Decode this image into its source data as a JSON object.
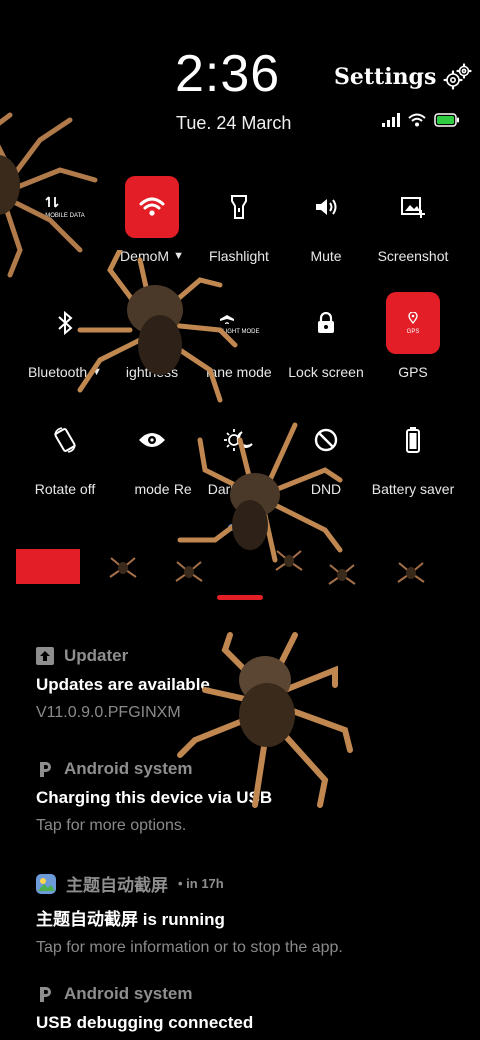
{
  "header": {
    "time": "2:36",
    "date": "Tue. 24 March",
    "settings_label": "Settings"
  },
  "tiles": [
    {
      "label": "",
      "icon": "mobile-data-icon",
      "small": "MOBILE DATA",
      "active": false
    },
    {
      "label": "DemoM",
      "icon": "wifi-icon",
      "active": true,
      "dropdown": true
    },
    {
      "label": "Flashlight",
      "icon": "flashlight-icon",
      "active": false
    },
    {
      "label": "Mute",
      "icon": "volume-icon",
      "active": false
    },
    {
      "label": "Screenshot",
      "icon": "screenshot-icon",
      "active": false
    },
    {
      "label": "Bluetooth",
      "icon": "bluetooth-icon",
      "active": false,
      "dropdown": true
    },
    {
      "label": "ightness",
      "icon": "brightness-icon",
      "active": false
    },
    {
      "label": "lane mode",
      "icon": "airplane-icon",
      "small": "FLIGHT MODE",
      "active": false
    },
    {
      "label": "Lock screen",
      "icon": "lock-icon",
      "active": false
    },
    {
      "label": "GPS",
      "icon": "gps-icon",
      "small": "GPS",
      "active": true
    },
    {
      "label": "Rotate off",
      "icon": "rotate-icon",
      "active": false
    },
    {
      "label": "mode",
      "icon": "eye-icon",
      "active": false
    },
    {
      "label": "Dark mode",
      "icon": "dark-mode-icon",
      "active": false,
      "prefix": "Re"
    },
    {
      "label": "DND",
      "icon": "dnd-icon",
      "active": false
    },
    {
      "label": "Battery saver",
      "icon": "battery-icon",
      "active": false
    }
  ],
  "notifications": [
    {
      "app": "Updater",
      "time": "",
      "title": "Updates are available",
      "body": "V11.0.9.0.PFGINXM"
    },
    {
      "app": "Android system",
      "time": "",
      "title": "Charging this device via USB",
      "body": "Tap for more options."
    },
    {
      "app": "主题自动截屏",
      "time": "• in 17h",
      "title": "主题自动截屏 is running",
      "body": "Tap for more information or to stop the app."
    },
    {
      "app": "Android system",
      "time": "",
      "title": "USB debugging connected",
      "body": ""
    }
  ],
  "colors": {
    "accent": "#e31e27",
    "background": "#000000",
    "muted": "#8e8e8e",
    "battery": "#2ecc40"
  }
}
